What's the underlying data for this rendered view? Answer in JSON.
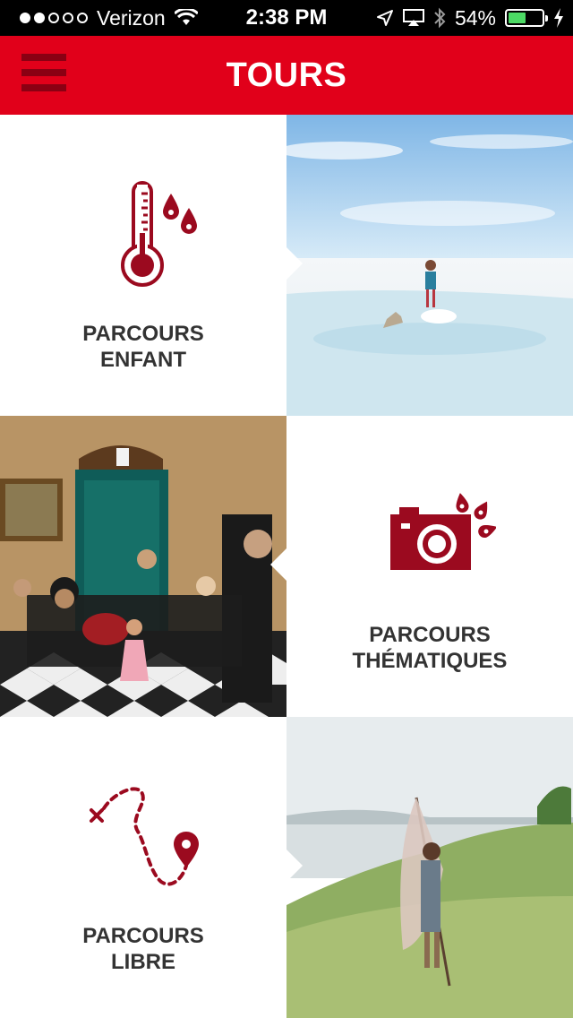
{
  "status_bar": {
    "carrier": "Verizon",
    "time": "2:38 PM",
    "battery_percent": "54%",
    "battery_level": 0.54,
    "signal_bars_filled": 2,
    "signal_bars_total": 5
  },
  "header": {
    "title": "TOURS",
    "menu_icon": "hamburger-menu-icon"
  },
  "tours": [
    {
      "line1": "PARCOURS",
      "line2": "ENFANT",
      "icon": "thermometer-icon",
      "photo": "salt-flat-photo"
    },
    {
      "line1": "PARCOURS",
      "line2": "THÉMATIQUES",
      "icon": "camera-icon",
      "photo": "family-portrait-photo"
    },
    {
      "line1": "PARCOURS",
      "line2": "LIBRE",
      "icon": "route-map-icon",
      "photo": "field-figure-photo"
    }
  ],
  "colors": {
    "brand_red": "#e1001a",
    "dark_red": "#9b0a1f",
    "text_dark": "#333333"
  }
}
